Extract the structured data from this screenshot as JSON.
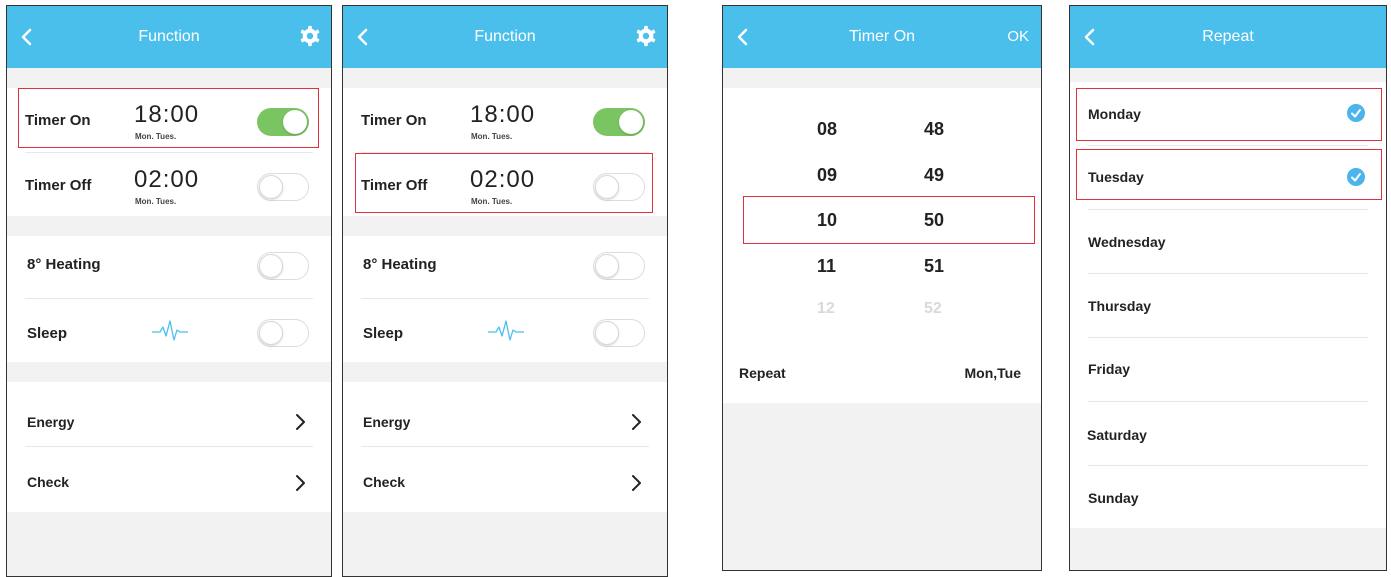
{
  "screens": [
    {
      "title": "Function",
      "timer_on": {
        "label": "Timer On",
        "time": "18:00",
        "days": "Mon. Tues."
      },
      "timer_off": {
        "label": "Timer Off",
        "time": "02:00",
        "days": "Mon. Tues."
      },
      "heating": {
        "label": "8° Heating"
      },
      "sleep": {
        "label": "Sleep"
      },
      "energy": {
        "label": "Energy"
      },
      "check": {
        "label": "Check"
      }
    },
    {
      "title": "Function",
      "timer_on": {
        "label": "Timer On",
        "time": "18:00",
        "days": "Mon. Tues."
      },
      "timer_off": {
        "label": "Timer Off",
        "time": "02:00",
        "days": "Mon. Tues."
      },
      "heating": {
        "label": "8° Heating"
      },
      "sleep": {
        "label": "Sleep"
      },
      "energy": {
        "label": "Energy"
      },
      "check": {
        "label": "Check"
      }
    },
    {
      "title": "Timer On",
      "ok_label": "OK",
      "hours": [
        "08",
        "09",
        "10",
        "11",
        "12"
      ],
      "minutes": [
        "48",
        "49",
        "50",
        "51",
        "52"
      ],
      "selected_hour": "10",
      "selected_minute": "50",
      "repeat_label": "Repeat",
      "repeat_value": "Mon,Tue"
    },
    {
      "title": "Repeat",
      "days": [
        {
          "label": "Monday",
          "checked": true
        },
        {
          "label": "Tuesday",
          "checked": true
        },
        {
          "label": "Wednesday",
          "checked": false
        },
        {
          "label": "Thursday",
          "checked": false
        },
        {
          "label": "Friday",
          "checked": false
        },
        {
          "label": "Saturday",
          "checked": false
        },
        {
          "label": "Sunday",
          "checked": false
        }
      ]
    }
  ],
  "toggles": {
    "timer_on": "on",
    "timer_off": "off",
    "heating": "off",
    "sleep": "off"
  },
  "colors": {
    "header": "#4bbfeb",
    "toggle_on": "#7bc462",
    "highlight": "#e0303a",
    "check": "#4bb4ea"
  },
  "icons": {
    "back": "chevron-left-icon",
    "settings": "gear-icon",
    "sleep": "pulse-wave-icon",
    "navigate": "chevron-right-icon",
    "checked": "check-circle-icon"
  }
}
